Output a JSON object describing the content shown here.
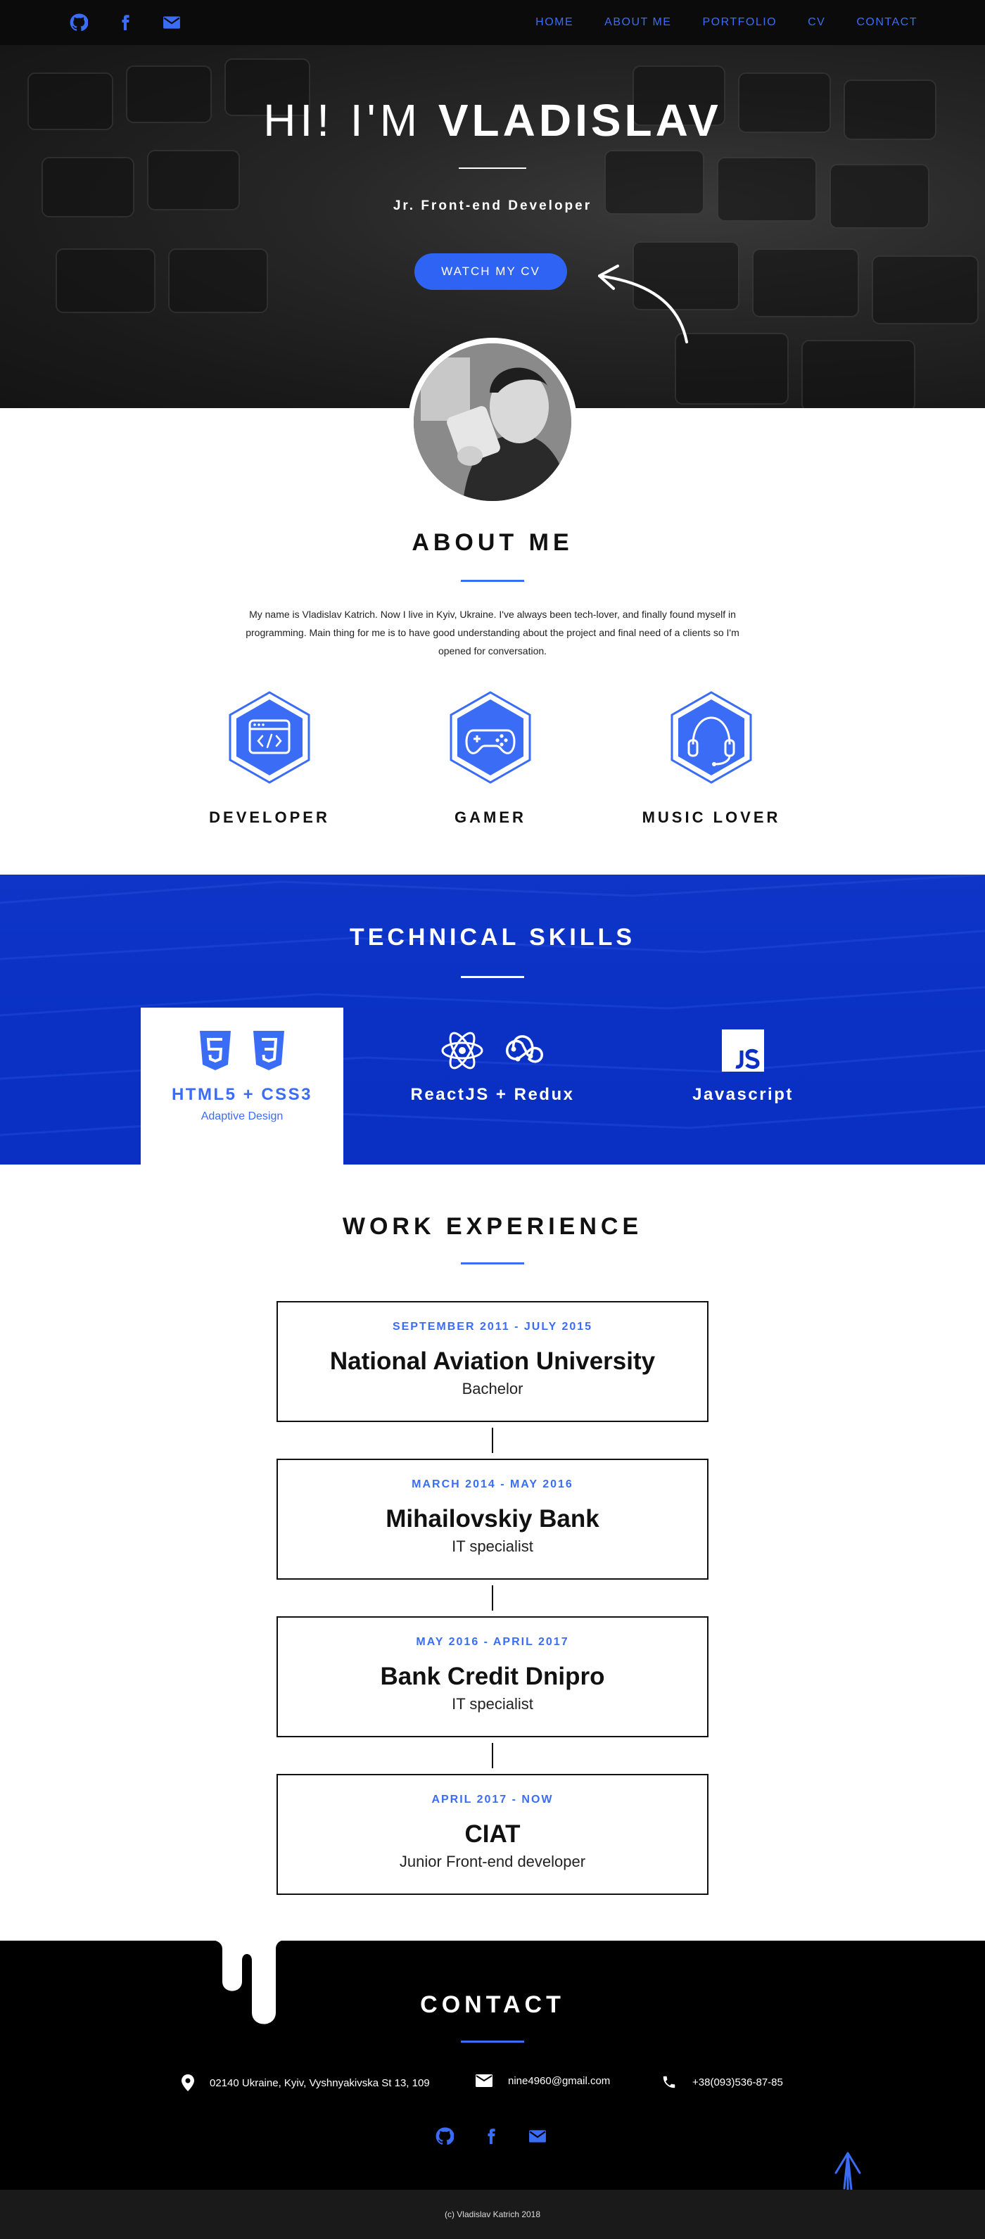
{
  "nav": {
    "social": [
      "github-icon",
      "facebook-icon",
      "mail-icon"
    ],
    "links": [
      "HOME",
      "ABOUT ME",
      "PORTFOLIO",
      "CV",
      "CONTACT"
    ]
  },
  "hero": {
    "greeting": "HI! I'M",
    "name": "VLADISLAV",
    "subtitle": "Jr. Front-end Developer",
    "cta": "WATCH MY CV"
  },
  "about": {
    "title": "ABOUT ME",
    "text": "My name is Vladislav Katrich. Now I live in Kyiv, Ukraine. I've always been tech-lover, and finally found myself in programming. Main thing for me is to have good understanding about the project and final need of a clients so I'm opened for conversation.",
    "traits": [
      {
        "label": "DEVELOPER",
        "icon": "code-window-icon"
      },
      {
        "label": "GAMER",
        "icon": "gamepad-icon"
      },
      {
        "label": "MUSIC LOVER",
        "icon": "headset-icon"
      }
    ]
  },
  "skills": {
    "title": "TECHNICAL SKILLS",
    "items": [
      {
        "name": "HTML5 + CSS3",
        "sub": "Adaptive Design",
        "icons": [
          "html5-icon",
          "css3-icon"
        ],
        "active": true
      },
      {
        "name": "ReactJS + Redux",
        "sub": "",
        "icons": [
          "react-icon",
          "redux-icon"
        ],
        "active": false
      },
      {
        "name": "Javascript",
        "sub": "",
        "icons": [
          "javascript-icon"
        ],
        "active": false
      }
    ]
  },
  "work": {
    "title": "WORK EXPERIENCE",
    "jobs": [
      {
        "period": "SEPTEMBER 2011 - JULY 2015",
        "org": "National Aviation University",
        "role": "Bachelor"
      },
      {
        "period": "MARCH 2014 - MAY 2016",
        "org": "Mihailovskiy Bank",
        "role": "IT specialist"
      },
      {
        "period": "MAY 2016 - APRIL 2017",
        "org": "Bank Credit Dnipro",
        "role": "IT specialist"
      },
      {
        "period": "APRIL 2017 - NOW",
        "org": "CIAT",
        "role": "Junior Front-end developer"
      }
    ]
  },
  "contact": {
    "title": "CONTACT",
    "address": "02140 Ukraine, Kyiv, Vyshnyakivska St 13, 109",
    "email": "nine4960@gmail.com",
    "phone": "+38(093)536-87-85",
    "social": [
      "github-icon",
      "facebook-icon",
      "mail-icon"
    ]
  },
  "footer": {
    "text": "(c) Vladislav Katrich 2018"
  },
  "colors": {
    "accent": "#3b6cf6",
    "skills_bg": "#0a31c4",
    "dark": "#0b0b0b"
  }
}
